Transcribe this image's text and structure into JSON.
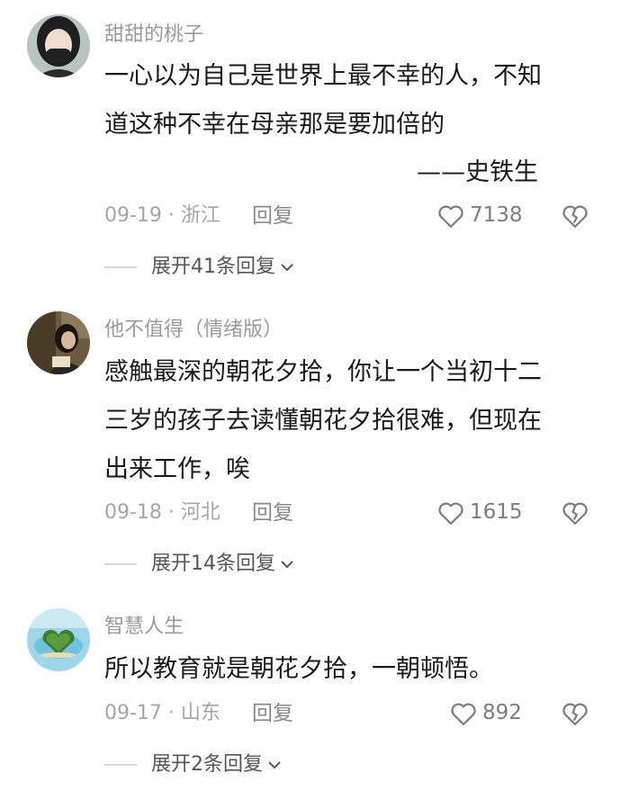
{
  "comments": [
    {
      "username": "甜甜的桃子",
      "lines": [
        "一心以为自己是世界上最不幸的人，不知",
        "道这种不幸在母亲那是要加倍的"
      ],
      "signature": "——史铁生",
      "date_location": "09-19 · 浙江",
      "reply_label": "回复",
      "likes": "7138",
      "expand_label": "展开41条回复",
      "avatar_icon": "avatar-girl-mask"
    },
    {
      "username": "他不值得（情绪版）",
      "lines": [
        "感触最深的朝花夕拾，你让一个当初十二",
        "三岁的孩子去读懂朝花夕拾很难，但现在",
        "出来工作，唉"
      ],
      "date_location": "09-18 · 河北",
      "reply_label": "回复",
      "likes": "1615",
      "expand_label": "展开14条回复",
      "avatar_icon": "avatar-girl-reading"
    },
    {
      "username": "智慧人生",
      "lines": [
        "所以教育就是朝花夕拾，一朝顿悟。"
      ],
      "date_location": "09-17 · 山东",
      "reply_label": "回复",
      "likes": "892",
      "expand_label": "展开2条回复",
      "avatar_icon": "avatar-heart-island"
    }
  ],
  "colors": {
    "username": "#9a9a9a",
    "text": "#1a1a1a",
    "meta": "#a5a5a5",
    "icon": "#8a8a8a"
  }
}
